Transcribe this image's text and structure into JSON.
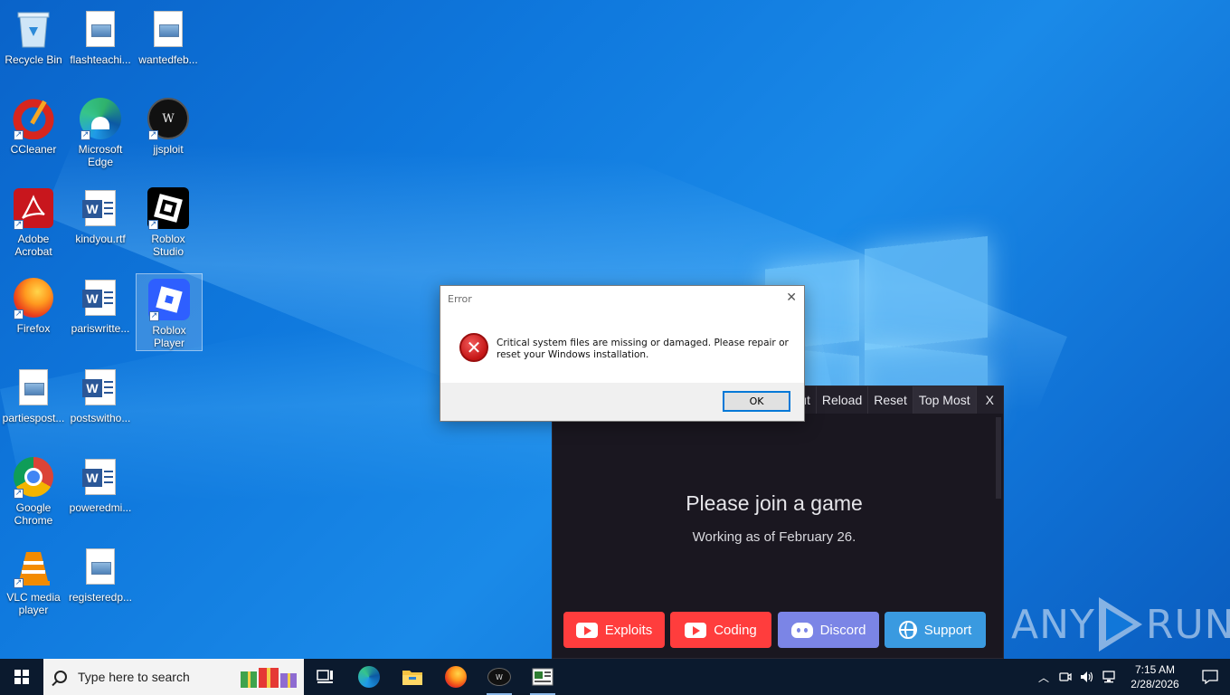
{
  "desktop": {
    "icons": [
      {
        "label": "Recycle Bin"
      },
      {
        "label": "flashteachi..."
      },
      {
        "label": "wantedfeb..."
      },
      {
        "label": "CCleaner"
      },
      {
        "label": "Microsoft Edge"
      },
      {
        "label": "jjsploit"
      },
      {
        "label": "Adobe Acrobat"
      },
      {
        "label": "kindyou.rtf"
      },
      {
        "label": "Roblox Studio"
      },
      {
        "label": "Firefox"
      },
      {
        "label": "pariswritte..."
      },
      {
        "label": "Roblox Player"
      },
      {
        "label": "partiespost..."
      },
      {
        "label": "postswitho..."
      },
      {
        "label": "Google Chrome"
      },
      {
        "label": "poweredmi..."
      },
      {
        "label": "VLC media player"
      },
      {
        "label": "registeredp..."
      }
    ]
  },
  "executor": {
    "toolbar": [
      "ut",
      "Reload",
      "Reset",
      "Top Most",
      "X"
    ],
    "title": "Please join a game",
    "subtitle": "Working as of February 26.",
    "buttons": [
      {
        "label": "Exploits",
        "color": "#ff3d3d"
      },
      {
        "label": "Coding",
        "color": "#ff3d3d"
      },
      {
        "label": "Discord",
        "color": "#7b85e6"
      },
      {
        "label": "Support",
        "color": "#3a9ae0"
      }
    ]
  },
  "dialog": {
    "title": "Error",
    "close": "✕",
    "message": "Critical system files are missing or damaged. Please repair or reset your Windows installation.",
    "ok_label": "OK"
  },
  "watermark": {
    "left": "ANY",
    "right": "RUN"
  },
  "taskbar": {
    "search_placeholder": "Type here to search",
    "time": "7:15 AM",
    "date": "2/28/2026"
  }
}
